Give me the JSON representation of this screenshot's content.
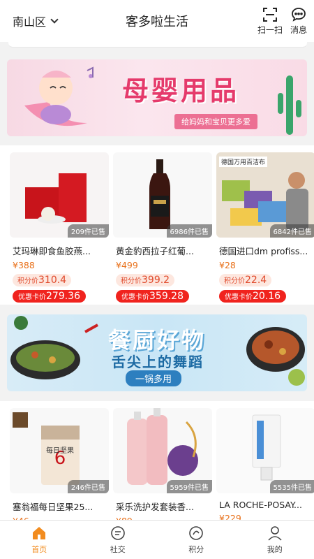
{
  "header": {
    "region": "南山区",
    "title": "客多啦生活",
    "scan_label": "扫一扫",
    "message_label": "消息"
  },
  "banners": [
    {
      "title": "母婴用品",
      "subtitle": "给妈妈和宝贝更多爱"
    },
    {
      "title": "餐厨好物",
      "subtitle": "舌尖上的舞蹈",
      "tag": "一锅多用"
    }
  ],
  "products_row1": [
    {
      "name": "艾玛琳即食鱼胶燕...",
      "price": "¥388",
      "sold": "209件已售",
      "points_label": "积分价",
      "points": "310.4",
      "vip_label": "优惠卡价",
      "vip_price": "279.36"
    },
    {
      "name": "黄金豹西拉子红葡...",
      "price": "¥499",
      "sold": "6986件已售",
      "points_label": "积分价",
      "points": "399.2",
      "vip_label": "优惠卡价",
      "vip_price": "359.28"
    },
    {
      "name": "德国进口dm profiss...",
      "price": "¥28",
      "sold": "6842件已售",
      "points_label": "积分价",
      "points": "22.4",
      "vip_label": "优惠卡价",
      "vip_price": "20.16",
      "image_text": "德国万用百洁布"
    }
  ],
  "products_row2": [
    {
      "name": "塞翁福每日坚果25...",
      "price": "¥46",
      "sold": "246件已售",
      "image_text": "每日坚果"
    },
    {
      "name": "采乐洗护发套装香...",
      "price": "¥89",
      "sold": "5959件已售"
    },
    {
      "name": "LA ROCHE-POSAY...",
      "price": "¥229",
      "sold": "5535件已售"
    }
  ],
  "tabs": [
    {
      "label": "首页",
      "icon": "home-icon",
      "active": true
    },
    {
      "label": "社交",
      "icon": "chat-icon",
      "active": false
    },
    {
      "label": "积分",
      "icon": "points-icon",
      "active": false
    },
    {
      "label": "我的",
      "icon": "user-icon",
      "active": false
    }
  ],
  "colors": {
    "accent": "#f28c1f",
    "price": "#e8701a",
    "vip_badge": "#f0231e"
  }
}
